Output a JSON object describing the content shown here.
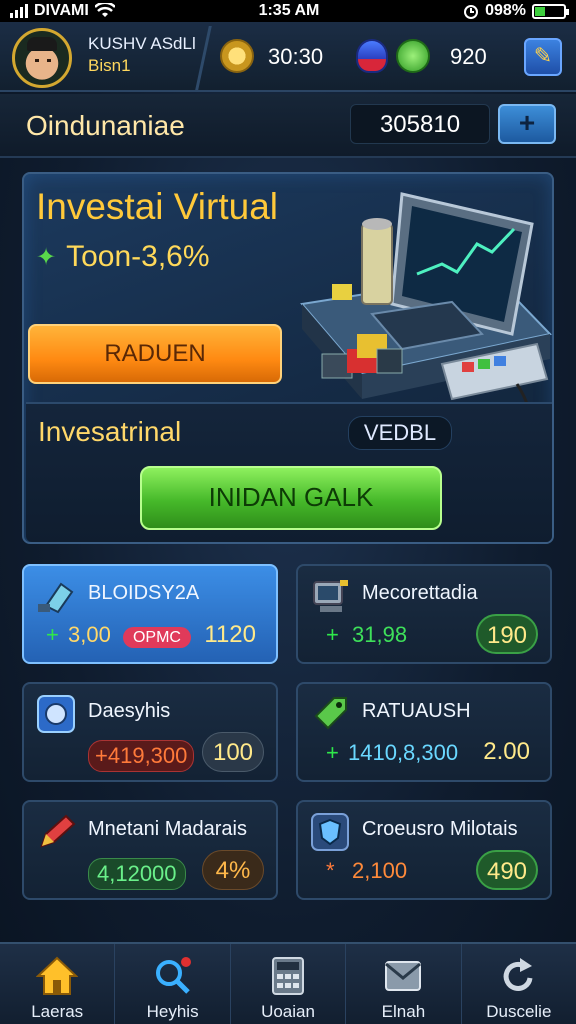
{
  "status_bar": {
    "carrier": "DIVAMI",
    "time": "1:35 AM",
    "battery_text": "098%"
  },
  "hud": {
    "player_name": "KUSHV ASdLl",
    "player_level": "Bisn1",
    "coins": "30:30",
    "cash": "920"
  },
  "section": {
    "title": "Oindunaniae",
    "balance": "305810",
    "action_label": "+"
  },
  "hero": {
    "title": "Investai Virtual",
    "return_label": "Toon-3,6%",
    "button_label": "RADUEN",
    "inner_title": "Invesatrinal",
    "inner_tag": "VEDBL",
    "inner_button_label": "INIDAN GALK"
  },
  "tiles": [
    {
      "title": "BLOIDSY2A",
      "prefix": "+",
      "value": "3,00",
      "pill": "OPMC",
      "badge": "1120",
      "icon": "gem-tag-icon"
    },
    {
      "title": "Mecorettadia",
      "prefix": "+",
      "value": "31,98",
      "badge": "190",
      "icon": "computer-icon"
    },
    {
      "title": "Daesyhis",
      "prefix": "+",
      "value": "419,300",
      "badge": "100",
      "icon": "globe-icon"
    },
    {
      "title": "RATUAUSH",
      "prefix": "+",
      "value": "1410,8,300",
      "badge": "2.00",
      "icon": "tag-icon"
    },
    {
      "title": "Mnetani Madarais",
      "prefix": "",
      "value": "4,12000",
      "badge": "4%",
      "icon": "pencil-icon"
    },
    {
      "title": "Croeusro Milotais",
      "prefix": "*",
      "value": "2,100",
      "badge": "490",
      "icon": "shield-icon"
    }
  ],
  "nav": [
    {
      "label": "Laeras",
      "icon": "home-icon"
    },
    {
      "label": "Heyhis",
      "icon": "search-icon"
    },
    {
      "label": "Uoaian",
      "icon": "calculator-icon"
    },
    {
      "label": "Elnah",
      "icon": "mail-icon"
    },
    {
      "label": "Duscelie",
      "icon": "refresh-icon"
    }
  ],
  "colors": {
    "accent_gold": "#ffc93a",
    "orange_button": "#ff8a12",
    "green_button": "#46b92a",
    "active_tile": "#3c8ee6"
  }
}
